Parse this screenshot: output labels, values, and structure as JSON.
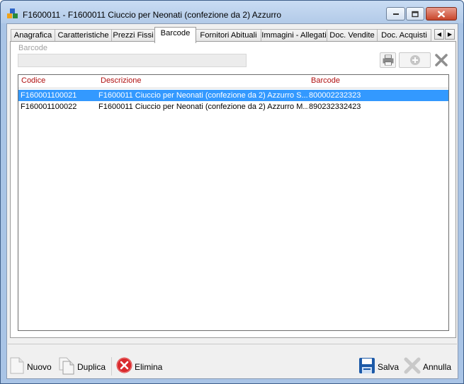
{
  "window": {
    "title": "F1600011 - F1600011 Ciuccio per Neonati (confezione da 2) Azzurro"
  },
  "tabs": [
    {
      "label": "Anagrafica",
      "active": false
    },
    {
      "label": "Caratteristiche",
      "active": false
    },
    {
      "label": "Prezzi Fissi",
      "active": false
    },
    {
      "label": "Barcode",
      "active": true
    },
    {
      "label": "Fornitori Abituali",
      "active": false
    },
    {
      "label": "Immagini - Allegati",
      "active": false
    },
    {
      "label": "Doc. Vendite",
      "active": false
    },
    {
      "label": "Doc. Acquisti",
      "active": false
    }
  ],
  "barcode_field": {
    "label": "Barcode",
    "value": ""
  },
  "grid": {
    "columns": [
      "Codice",
      "Descrizione",
      "Barcode"
    ],
    "rows": [
      {
        "codice": "F160001100021",
        "descrizione": "F1600011 Ciuccio per Neonati (confezione da 2) Azzurro S...",
        "barcode": "800002232323",
        "selected": true
      },
      {
        "codice": "F160001100022",
        "descrizione": "F1600011 Ciuccio per Neonati (confezione da 2) Azzurro M...",
        "barcode": "890232332423",
        "selected": false
      }
    ]
  },
  "footer": {
    "nuovo": "Nuovo",
    "duplica": "Duplica",
    "elimina": "Elimina",
    "salva": "Salva",
    "annulla": "Annulla"
  },
  "colors": {
    "selection": "#3399ff",
    "column_header": "#b01010",
    "window_frame": "#a9c4e6",
    "close_button": "#c8452b"
  },
  "icons": {
    "app": "app-colored-icon",
    "print": "print-icon",
    "add": "add-circle-icon",
    "delete": "delete-x-icon",
    "new": "new-document-icon",
    "duplicate": "duplicate-icon",
    "remove": "error-circle-icon",
    "save": "floppy-disk-icon",
    "cancel": "cancel-x-icon"
  }
}
